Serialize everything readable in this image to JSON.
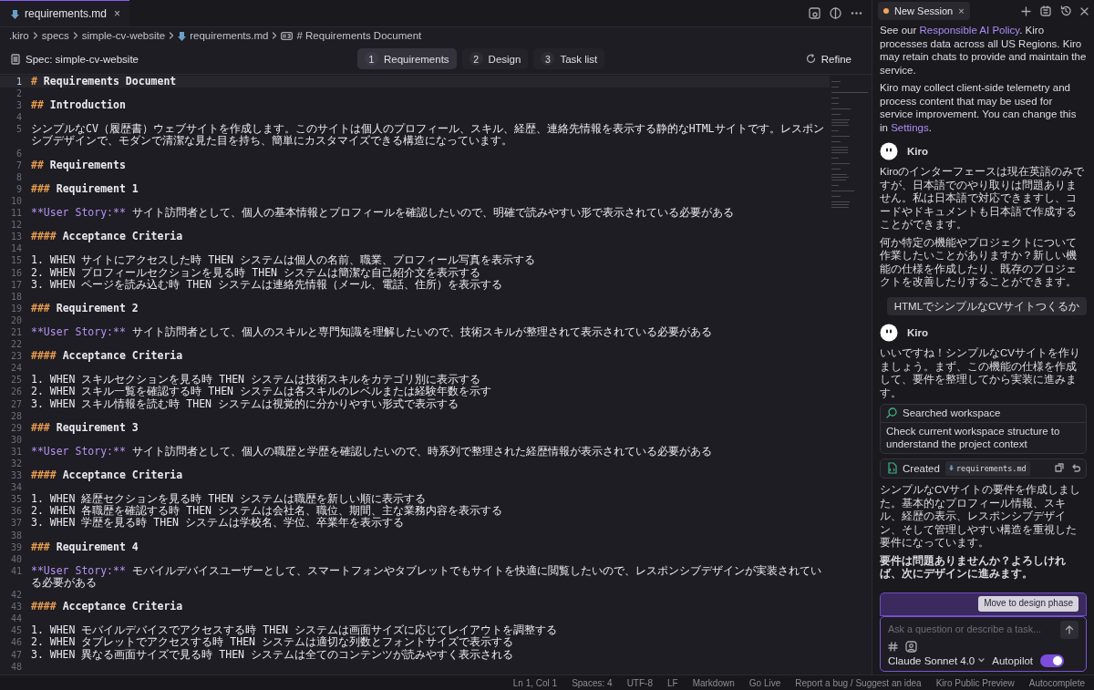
{
  "editor_tabs": [
    {
      "label": "requirements.md",
      "close": "×",
      "selected": true
    }
  ],
  "breadcrumb": [
    {
      "label": ".kiro",
      "kind": "folder"
    },
    {
      "label": "specs",
      "kind": "folder"
    },
    {
      "label": "simple-cv-website",
      "kind": "folder"
    },
    {
      "label": "requirements.md",
      "kind": "file"
    },
    {
      "label": "# Requirements Document",
      "kind": "symbol"
    }
  ],
  "spec_bar": {
    "title": "Spec: simple-cv-website",
    "steps": [
      {
        "number": "1",
        "label": "Requirements",
        "selected": true
      },
      {
        "number": "2",
        "label": "Design",
        "selected": false
      },
      {
        "number": "3",
        "label": "Task list",
        "selected": false
      }
    ],
    "refine": "Refine"
  },
  "editor": {
    "lines": [
      {
        "n": "1",
        "kind": "heading",
        "marker": "#",
        "text": "Requirements Document",
        "current": true
      },
      {
        "n": "2",
        "kind": "blank",
        "current": false
      },
      {
        "n": "3",
        "kind": "heading",
        "marker": "##",
        "text": "Introduction",
        "current": false
      },
      {
        "n": "4",
        "kind": "blank",
        "current": false
      },
      {
        "n": "5",
        "kind": "text",
        "text": "シンプルなCV（履歴書）ウェブサイトを作成します。このサイトは個人のプロフィール、スキル、経歴、連絡先情報を表示する静的なHTMLサイトです。レスポンシブデザインで、モダンで清潔な見た目を持ち、簡単にカスタマイズできる構造になっています。",
        "current": false
      },
      {
        "n": "6",
        "kind": "blank",
        "current": false
      },
      {
        "n": "7",
        "kind": "heading",
        "marker": "##",
        "text": "Requirements",
        "current": false
      },
      {
        "n": "8",
        "kind": "blank",
        "current": false
      },
      {
        "n": "9",
        "kind": "heading",
        "marker": "###",
        "text": "Requirement 1",
        "current": false
      },
      {
        "n": "10",
        "kind": "blank",
        "current": false
      },
      {
        "n": "11",
        "kind": "story",
        "marker": "**User Story:**",
        "text": "サイト訪問者として、個人の基本情報とプロフィールを確認したいので、明確で読みやすい形で表示されている必要がある",
        "current": false
      },
      {
        "n": "12",
        "kind": "blank",
        "current": false
      },
      {
        "n": "13",
        "kind": "heading",
        "marker": "####",
        "text": "Acceptance Criteria",
        "current": false
      },
      {
        "n": "14",
        "kind": "blank",
        "current": false
      },
      {
        "n": "15",
        "kind": "text",
        "text": "1. WHEN サイトにアクセスした時 THEN システムは個人の名前、職業、プロフィール写真を表示する",
        "current": false
      },
      {
        "n": "16",
        "kind": "text",
        "text": "2. WHEN プロフィールセクションを見る時 THEN システムは簡潔な自己紹介文を表示する",
        "current": false
      },
      {
        "n": "17",
        "kind": "text",
        "text": "3. WHEN ページを読み込む時 THEN システムは連絡先情報（メール、電話、住所）を表示する",
        "current": false
      },
      {
        "n": "18",
        "kind": "blank",
        "current": false
      },
      {
        "n": "19",
        "kind": "heading",
        "marker": "###",
        "text": "Requirement 2",
        "current": false
      },
      {
        "n": "20",
        "kind": "blank",
        "current": false
      },
      {
        "n": "21",
        "kind": "story",
        "marker": "**User Story:**",
        "text": "サイト訪問者として、個人のスキルと専門知識を理解したいので、技術スキルが整理されて表示されている必要がある",
        "current": false
      },
      {
        "n": "22",
        "kind": "blank",
        "current": false
      },
      {
        "n": "23",
        "kind": "heading",
        "marker": "####",
        "text": "Acceptance Criteria",
        "current": false
      },
      {
        "n": "24",
        "kind": "blank",
        "current": false
      },
      {
        "n": "25",
        "kind": "text",
        "text": "1. WHEN スキルセクションを見る時 THEN システムは技術スキルをカテゴリ別に表示する",
        "current": false
      },
      {
        "n": "26",
        "kind": "text",
        "text": "2. WHEN スキル一覧を確認する時 THEN システムは各スキルのレベルまたは経験年数を示す",
        "current": false
      },
      {
        "n": "27",
        "kind": "text",
        "text": "3. WHEN スキル情報を読む時 THEN システムは視覚的に分かりやすい形式で表示する",
        "current": false
      },
      {
        "n": "28",
        "kind": "blank",
        "current": false
      },
      {
        "n": "29",
        "kind": "heading",
        "marker": "###",
        "text": "Requirement 3",
        "current": false
      },
      {
        "n": "30",
        "kind": "blank",
        "current": false
      },
      {
        "n": "31",
        "kind": "story",
        "marker": "**User Story:**",
        "text": "サイト訪問者として、個人の職歴と学歴を確認したいので、時系列で整理された経歴情報が表示されている必要がある",
        "current": false
      },
      {
        "n": "32",
        "kind": "blank",
        "current": false
      },
      {
        "n": "33",
        "kind": "heading",
        "marker": "####",
        "text": "Acceptance Criteria",
        "current": false
      },
      {
        "n": "34",
        "kind": "blank",
        "current": false
      },
      {
        "n": "35",
        "kind": "text",
        "text": "1. WHEN 経歴セクションを見る時 THEN システムは職歴を新しい順に表示する",
        "current": false
      },
      {
        "n": "36",
        "kind": "text",
        "text": "2. WHEN 各職歴を確認する時 THEN システムは会社名、職位、期間、主な業務内容を表示する",
        "current": false
      },
      {
        "n": "37",
        "kind": "text",
        "text": "3. WHEN 学歴を見る時 THEN システムは学校名、学位、卒業年を表示する",
        "current": false
      },
      {
        "n": "38",
        "kind": "blank",
        "current": false
      },
      {
        "n": "39",
        "kind": "heading",
        "marker": "###",
        "text": "Requirement 4",
        "current": false
      },
      {
        "n": "40",
        "kind": "blank",
        "current": false
      },
      {
        "n": "41",
        "kind": "story",
        "marker": "**User Story:**",
        "text": "モバイルデバイスユーザーとして、スマートフォンやタブレットでもサイトを快適に閲覧したいので、レスポンシブデザインが実装されている必要がある",
        "current": false
      },
      {
        "n": "42",
        "kind": "blank",
        "current": false
      },
      {
        "n": "43",
        "kind": "heading",
        "marker": "####",
        "text": "Acceptance Criteria",
        "current": false
      },
      {
        "n": "44",
        "kind": "blank",
        "current": false
      },
      {
        "n": "45",
        "kind": "text",
        "text": "1. WHEN モバイルデバイスでアクセスする時 THEN システムは画面サイズに応じてレイアウトを調整する",
        "current": false
      },
      {
        "n": "46",
        "kind": "text",
        "text": "2. WHEN タブレットでアクセスする時 THEN システムは適切な列数とフォントサイズで表示する",
        "current": false
      },
      {
        "n": "47",
        "kind": "text",
        "text": "3. WHEN 異なる画面サイズで見る時 THEN システムは全てのコンテンツが読みやすく表示される",
        "current": false
      },
      {
        "n": "48",
        "kind": "blank",
        "current": false
      }
    ]
  },
  "chat": {
    "session_tab": "New Session",
    "session_close": "×",
    "messages": [
      {
        "kind": "notice",
        "before": "See our ",
        "link": "Responsible AI Policy",
        "after": ". Kiro processes data across all US Regions. Kiro may retain chats to provide and maintain the service."
      },
      {
        "kind": "notice",
        "before": "Kiro may collect client-side telemetry and process content that may be used for service improvement. You can change this in ",
        "link": "Settings",
        "after": "."
      },
      {
        "kind": "agent",
        "name": "Kiro"
      },
      {
        "kind": "text",
        "text": "Kiroのインターフェースは現在英語のみですが、日本語でのやり取りは問題ありません。私は日本語で対応できますし、コードやドキュメントも日本語で作成することができます。"
      },
      {
        "kind": "text",
        "text": "何か特定の機能やプロジェクトについて作業したいことがありますか？新しい機能の仕様を作成したり、既存のプロジェクトを改善したりすることができます。"
      },
      {
        "kind": "user",
        "text": "HTMLでシンプルなCVサイトつくるか"
      },
      {
        "kind": "agent",
        "name": "Kiro"
      },
      {
        "kind": "text",
        "text": "いいですね！シンプルなCVサイトを作りましょう。まず、この機能の仕様を作成して、要件を整理してから実装に進みます。"
      },
      {
        "kind": "search",
        "title": "Searched workspace",
        "detail": "Check current workspace structure to understand the project context"
      },
      {
        "kind": "created",
        "title": "Created",
        "file": "requirements.md"
      },
      {
        "kind": "text",
        "text": "シンプルなCVサイトの要件を作成しました。基本的なプロフィール情報、スキル、経歴の表示、レスポンシブデザイン、そして管理しやすい構造を重視した要件になっています。"
      },
      {
        "kind": "bold",
        "text": "要件は問題ありませんか？よろしければ、次にデザインに進みます。"
      }
    ],
    "action": "Move to design phase",
    "input": {
      "placeholder": "Ask a question or describe a task...",
      "model": "Claude Sonnet 4.0",
      "autopilot_label": "Autopilot",
      "autopilot": true
    }
  },
  "status_bar": [
    "Ln 1, Col 1",
    "Spaces: 4",
    "UTF-8",
    "LF",
    "Markdown",
    "Go Live",
    "Report a bug / Suggest an idea",
    "Kiro Public Preview",
    "Autocomplete"
  ]
}
